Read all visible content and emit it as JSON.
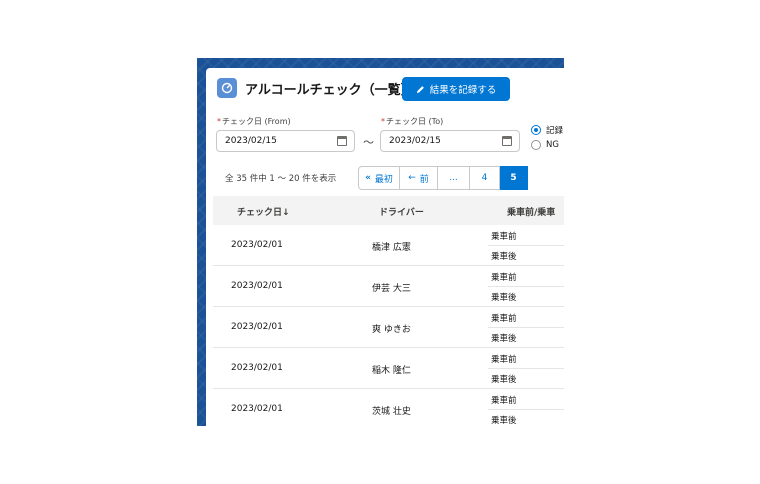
{
  "header": {
    "title": "アルコールチェック（一覧）",
    "record_button": "結果を記録する"
  },
  "filters": {
    "from_label": "チェック日 (From)",
    "from_value": "2023/02/15",
    "to_label": "チェック日 (To)",
    "to_value": "2023/02/15",
    "range_separator": "～",
    "radio_options": [
      {
        "label": "記録",
        "selected": true
      },
      {
        "label": "NG",
        "selected": false
      }
    ]
  },
  "pagination": {
    "summary": "全 35 件中 1 ～ 20 件を表示",
    "first": "最初",
    "prev": "前",
    "ellipsis": "...",
    "pages": [
      "4",
      "5"
    ],
    "current_page": "5"
  },
  "table": {
    "headers": [
      "チェック日↓",
      "ドライバー",
      "乗車前/乗車"
    ],
    "rows": [
      {
        "date": "2023/02/01",
        "driver": "橋津 広憲",
        "before": "乗車前",
        "after": "乗車後"
      },
      {
        "date": "2023/02/01",
        "driver": "伊芸 大三",
        "before": "乗車前",
        "after": "乗車後"
      },
      {
        "date": "2023/02/01",
        "driver": "爽 ゆきお",
        "before": "乗車前",
        "after": "乗車後"
      },
      {
        "date": "2023/02/01",
        "driver": "稲木 隆仁",
        "before": "乗車前",
        "after": "乗車後"
      },
      {
        "date": "2023/02/01",
        "driver": "茨城 壮史",
        "before": "乗車前",
        "after": "乗車後"
      }
    ]
  },
  "colors": {
    "brand_blue": "#0176d3",
    "background_blue": "#1b5297",
    "required_red": "#c23934"
  }
}
